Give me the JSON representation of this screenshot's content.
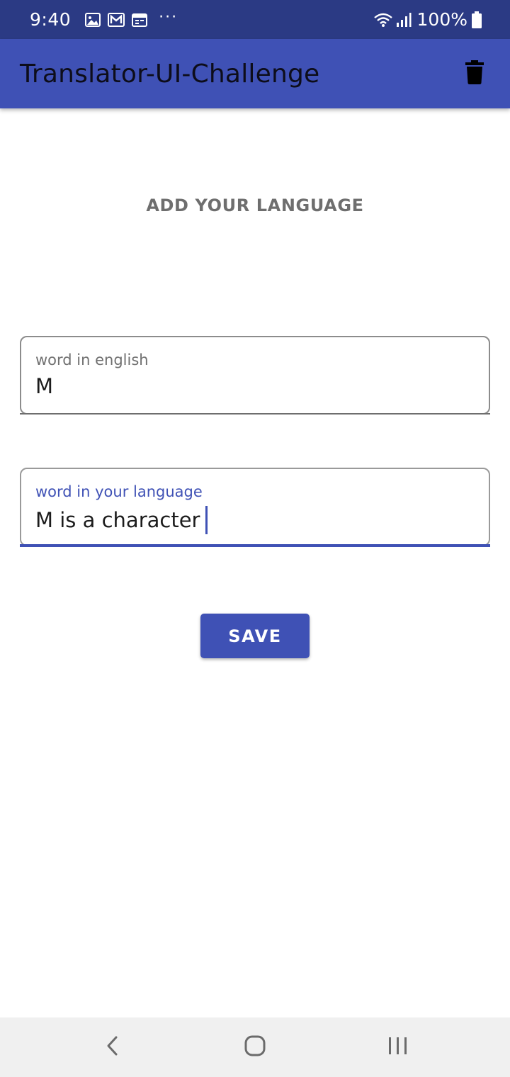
{
  "status_bar": {
    "time": "9:40",
    "icons": [
      "image-icon",
      "mail-icon",
      "calendar-icon"
    ],
    "overflow": "···",
    "battery_text": "100%"
  },
  "app_bar": {
    "title": "Translator-UI-Challenge",
    "action_icon": "trash-icon"
  },
  "main": {
    "heading": "ADD YOUR LANGUAGE",
    "english_field": {
      "label": "word in english",
      "value": "M"
    },
    "native_field": {
      "label": "word in your language",
      "value": "M is a character"
    },
    "save_label": "SAVE"
  },
  "nav_bar": {
    "icons": [
      "back-icon",
      "home-icon",
      "recents-icon"
    ]
  },
  "colors": {
    "status_bar": "#2b3a84",
    "primary": "#3f51b5",
    "heading_text": "#6e6e6e",
    "nav_bar": "#f0f0f0"
  }
}
